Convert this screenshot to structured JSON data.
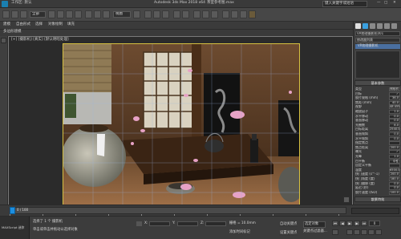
{
  "title_bar": {
    "workspace_label": "工作区: 默认",
    "app_title": "Autodesk 3ds Max 2018 x64",
    "file_title": "茶室参考图.max",
    "search_placeholder": "键入关键字或短语"
  },
  "toolbar": {
    "selection_filter": "全部",
    "view_dropdown": "视图"
  },
  "ribbon": {
    "tabs": [
      "建模",
      "自由形式",
      "选择",
      "对象绘制",
      "填充"
    ],
    "sub_label": "多边形建模"
  },
  "viewport": {
    "label": "[+] [摄影机] [真实] [默认明暗处理]"
  },
  "command_panel": {
    "object_name": "VR物理摄影机001",
    "modifier_list": "修改器列表",
    "modifier_item": "VR物理摄影机",
    "section_basic": "基本参数",
    "params": [
      {
        "label": "类型",
        "value": "照相机"
      },
      {
        "label": "目标",
        "value": "✓"
      },
      {
        "label": "胶片规格 (mm)",
        "value": "36.0"
      },
      {
        "label": "焦距 (mm)",
        "value": "40.0"
      },
      {
        "label": "视野",
        "value": "48.455"
      },
      {
        "label": "缩放因子",
        "value": "1.0"
      },
      {
        "label": "水平移动",
        "value": "0.0"
      },
      {
        "label": "垂直移动",
        "value": "0.0"
      },
      {
        "label": "光圈数",
        "value": "8.0"
      },
      {
        "label": "目标距离",
        "value": "2540.0"
      },
      {
        "label": "垂直倾斜",
        "value": "0.0"
      },
      {
        "label": "水平倾斜",
        "value": "0.0"
      },
      {
        "label": "指定焦点",
        "value": ""
      },
      {
        "label": "焦点距离",
        "value": "200.0"
      },
      {
        "label": "曝光",
        "value": "✓"
      },
      {
        "label": "光晕",
        "value": "1.0"
      },
      {
        "label": "白平衡",
        "value": "中性"
      },
      {
        "label": "自定义平衡",
        "value": ""
      },
      {
        "label": "温度",
        "value": "6500.0"
      },
      {
        "label": "快门速度 (s^-1)",
        "value": "200.0"
      },
      {
        "label": "快门角度 (度)",
        "value": "180.0"
      },
      {
        "label": "快门偏移 (度)",
        "value": "0.0"
      },
      {
        "label": "延迟 (秒)",
        "value": "0.0"
      },
      {
        "label": "胶片速度 (ISO)",
        "value": "100.0"
      }
    ],
    "section_bokeh": "散景特效"
  },
  "timeline": {
    "frame_display": "0 / 100",
    "ticks": [
      "0",
      "10",
      "20",
      "30",
      "40",
      "50",
      "60",
      "70",
      "80",
      "90",
      "100"
    ]
  },
  "status": {
    "maxscript_label": "MAXScript 迷你",
    "selection_info": "选择了 1 个 摄影机",
    "prompt": "单击或单击并拖动以选择对象",
    "x_label": "X:",
    "y_label": "Y:",
    "z_label": "Z:",
    "grid": "栅格 = 10.0mm",
    "add_time_tag": "添加时间标记",
    "auto_key": "自动关键点",
    "set_key": "设置关键点",
    "selected_dd": "选定对象",
    "key_filters": "关键点过滤器...",
    "frame": "0"
  },
  "colors": {
    "frame_border": "#d6c040",
    "accent_blue": "#1d8fe0",
    "petal_pink": "#e7a2c6"
  }
}
